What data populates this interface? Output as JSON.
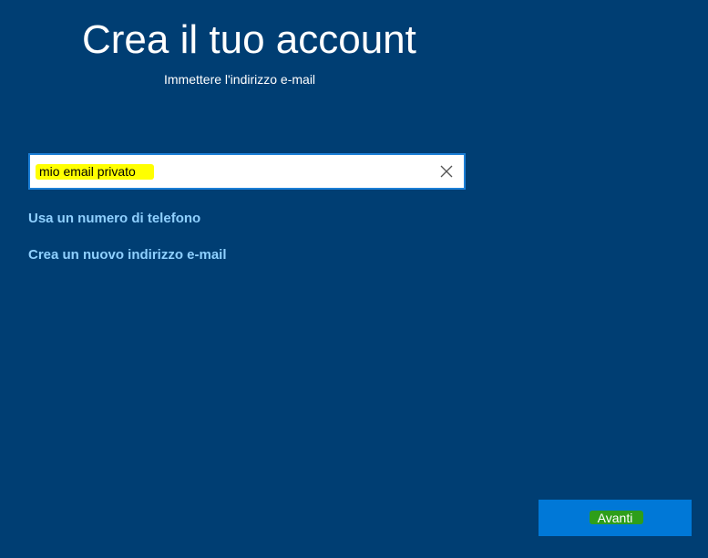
{
  "colors": {
    "background": "#003e73",
    "link": "#8fd0ff",
    "primary_button": "#0078d7",
    "input_border": "#1c7fd6",
    "email_highlight": "#ffff00",
    "button_highlight": "#2e9e1a"
  },
  "header": {
    "title": "Crea il tuo account",
    "subtitle": "Immettere l'indirizzo e-mail"
  },
  "email_field": {
    "value": "mio email privato",
    "clear_icon": "close-icon"
  },
  "links": {
    "phone": "Usa un numero di telefono",
    "new_email": "Crea un nuovo indirizzo e-mail"
  },
  "footer": {
    "next_label": "Avanti"
  }
}
